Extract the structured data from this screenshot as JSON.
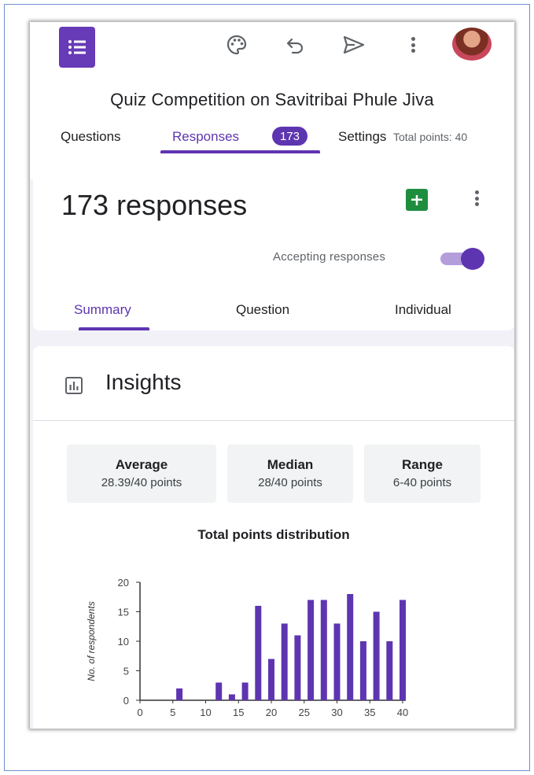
{
  "header": {
    "tools": [
      "palette-icon",
      "undo-icon",
      "send-icon",
      "more-vert-icon"
    ],
    "form_title": "Quiz Competition on Savitribai Phule Jiva"
  },
  "tabs": {
    "questions": "Questions",
    "responses": "Responses",
    "responses_badge": "173",
    "settings": "Settings",
    "total_points": "Total points: 40"
  },
  "responses_card": {
    "count_text": "173 responses",
    "accepting_label": "Accepting responses",
    "accepting": true,
    "subtabs": {
      "summary": "Summary",
      "question": "Question",
      "individual": "Individual"
    }
  },
  "insights": {
    "title": "Insights",
    "stats": {
      "average_label": "Average",
      "average_value": "28.39/40 points",
      "median_label": "Median",
      "median_value": "28/40 points",
      "range_label": "Range",
      "range_value": "6-40 points"
    }
  },
  "colors": {
    "accent": "#5e35b1",
    "accent_light": "#b39ddb",
    "sheets_green": "#1e8e3e"
  },
  "chart_data": {
    "type": "bar",
    "title": "Total points distribution",
    "xlabel": "",
    "ylabel": "No. of respondents",
    "xlim": [
      0,
      40
    ],
    "ylim": [
      0,
      20
    ],
    "x_ticks": [
      0,
      5,
      10,
      15,
      20,
      25,
      30,
      35,
      40
    ],
    "y_ticks": [
      0,
      5,
      10,
      15,
      20
    ],
    "x": [
      6,
      12,
      14,
      16,
      18,
      20,
      22,
      24,
      26,
      28,
      30,
      32,
      34,
      36,
      38,
      40
    ],
    "values": [
      2,
      3,
      1,
      3,
      16,
      7,
      13,
      11,
      17,
      17,
      13,
      18,
      10,
      15,
      10,
      17
    ],
    "color": "#5e35b1"
  }
}
